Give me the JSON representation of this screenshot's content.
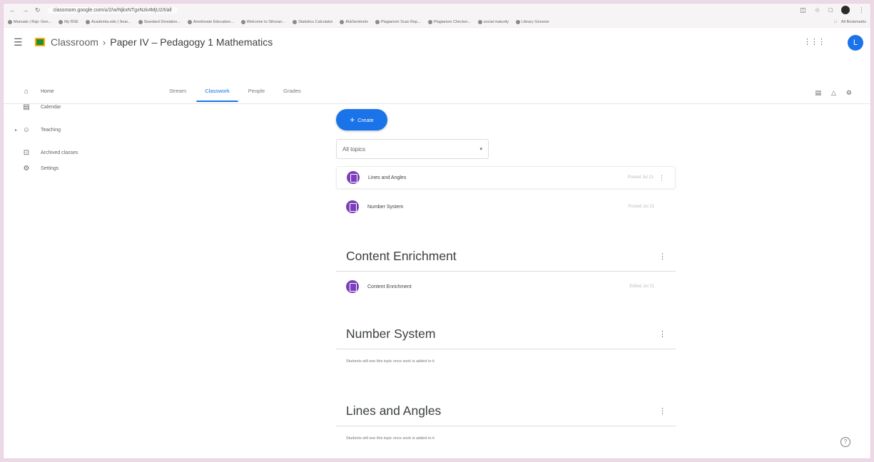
{
  "browser": {
    "url": "classroom.google.com/u/2/w/NjkxNTgxNzk4MjU2/t/all",
    "bookmarks": [
      "Manuals | Raji- Gen...",
      "My BSE",
      "Academia.edu | Sear...",
      "Standard Deviation...",
      "Ameliorate Education...",
      "Welcome to Sthoran...",
      "Statistics Calculator",
      "AI&Sentinels",
      "Plagiarism Scan Rep...",
      "Plagiarism Checker...",
      "social maturity",
      "Library Genesis"
    ],
    "all_bookmarks": "All Bookmarks"
  },
  "header": {
    "brand": "Classroom",
    "class_name": "Paper IV – Pedagogy 1 Mathematics",
    "avatar_letter": "L"
  },
  "sidebar": {
    "items": [
      {
        "label": "Home",
        "icon": "home-icon"
      },
      {
        "label": "Calendar",
        "icon": "calendar-icon"
      },
      {
        "label": "Teaching",
        "icon": "people-icon"
      },
      {
        "label": "Archived classes",
        "icon": "archive-icon"
      },
      {
        "label": "Settings",
        "icon": "settings-icon"
      }
    ]
  },
  "tabs": {
    "items": [
      "Stream",
      "Classwork",
      "People",
      "Grades"
    ],
    "active": "Classwork"
  },
  "main": {
    "create_label": "Create",
    "topic_filter": "All topics",
    "materials": [
      {
        "title": "Lines and Angles",
        "posted": "Posted Jul 21"
      },
      {
        "title": "Number System",
        "posted": "Posted Jul 21"
      }
    ],
    "topics": [
      {
        "title": "Content Enrichment",
        "items": [
          {
            "title": "Content Enrichment",
            "posted": "Edited Jul 21"
          }
        ]
      },
      {
        "title": "Number System",
        "empty_note": "Students will see this topic once work is added to it"
      },
      {
        "title": "Lines and Angles",
        "empty_note": "Students will see this topic once work is added to it"
      }
    ]
  },
  "colors": {
    "accent": "#1a73e8",
    "material_icon": "#7a3fb9",
    "border_tint": "#ecd9e6"
  }
}
